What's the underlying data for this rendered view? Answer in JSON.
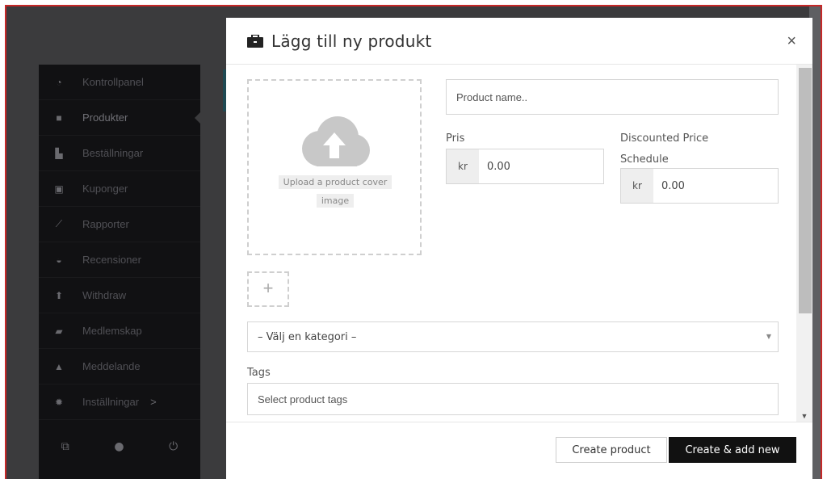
{
  "sidebar": {
    "items": [
      {
        "label": "Kontrollpanel",
        "icon": "dashboard-icon"
      },
      {
        "label": "Produkter",
        "icon": "briefcase-icon",
        "active": true
      },
      {
        "label": "Beställningar",
        "icon": "cart-icon"
      },
      {
        "label": "Kuponger",
        "icon": "gift-icon"
      },
      {
        "label": "Rapporter",
        "icon": "chart-icon"
      },
      {
        "label": "Recensioner",
        "icon": "comments-icon"
      },
      {
        "label": "Withdraw",
        "icon": "upload-icon"
      },
      {
        "label": "Medlemskap",
        "icon": "book-icon"
      },
      {
        "label": "Meddelande",
        "icon": "bell-icon"
      },
      {
        "label": "Inställningar",
        "icon": "gear-icon"
      }
    ],
    "settings_caret": ">"
  },
  "modal": {
    "title": "Lägg till ny produkt",
    "close_label": "×",
    "upload": {
      "line1": "Upload a product cover",
      "line2": "image"
    },
    "add_gallery_label": "+",
    "product_name_placeholder": "Product name..",
    "price": {
      "label": "Pris",
      "currency": "kr",
      "value": "0.00"
    },
    "discount": {
      "label_line1": "Discounted Price",
      "label_line2": "Schedule",
      "currency": "kr",
      "value": "0.00"
    },
    "category_select": "– Välj en kategori –",
    "tags": {
      "label": "Tags",
      "placeholder": "Select product tags"
    },
    "buttons": {
      "create": "Create product",
      "create_add": "Create & add new"
    }
  },
  "colors": {
    "frame_border": "#c62828",
    "sidebar_bg": "#111113",
    "backdrop": "#3b3b3d",
    "primary_btn": "#111111"
  }
}
